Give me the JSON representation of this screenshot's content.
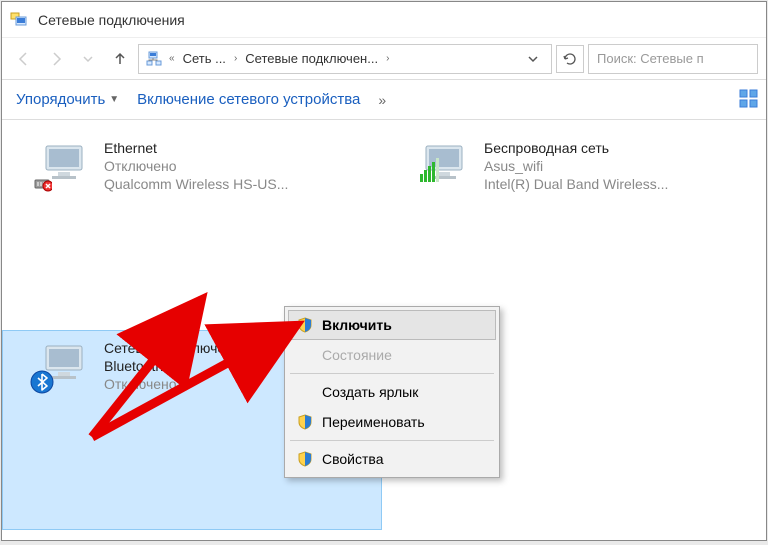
{
  "title": "Сетевые подключения",
  "breadcrumb": {
    "seg1": "Сеть ...",
    "seg2": "Сетевые подключен..."
  },
  "search_placeholder": "Поиск: Сетевые п",
  "toolbar": {
    "organize": "Упорядочить",
    "enable_device": "Включение сетевого устройства"
  },
  "connections": [
    {
      "name": "Ethernet",
      "status": "Отключено",
      "device": "Qualcomm Wireless HS-US..."
    },
    {
      "name": "Беспроводная сеть",
      "status": "Asus_wifi",
      "device": "Intel(R) Dual Band Wireless..."
    },
    {
      "name_l1": "Сетевое подключение",
      "name_l2": "Bluetooth",
      "status": "Отключено"
    }
  ],
  "ctx": {
    "enable": "Включить",
    "status": "Состояние",
    "shortcut": "Создать ярлык",
    "rename": "Переименовать",
    "properties": "Свойства"
  }
}
